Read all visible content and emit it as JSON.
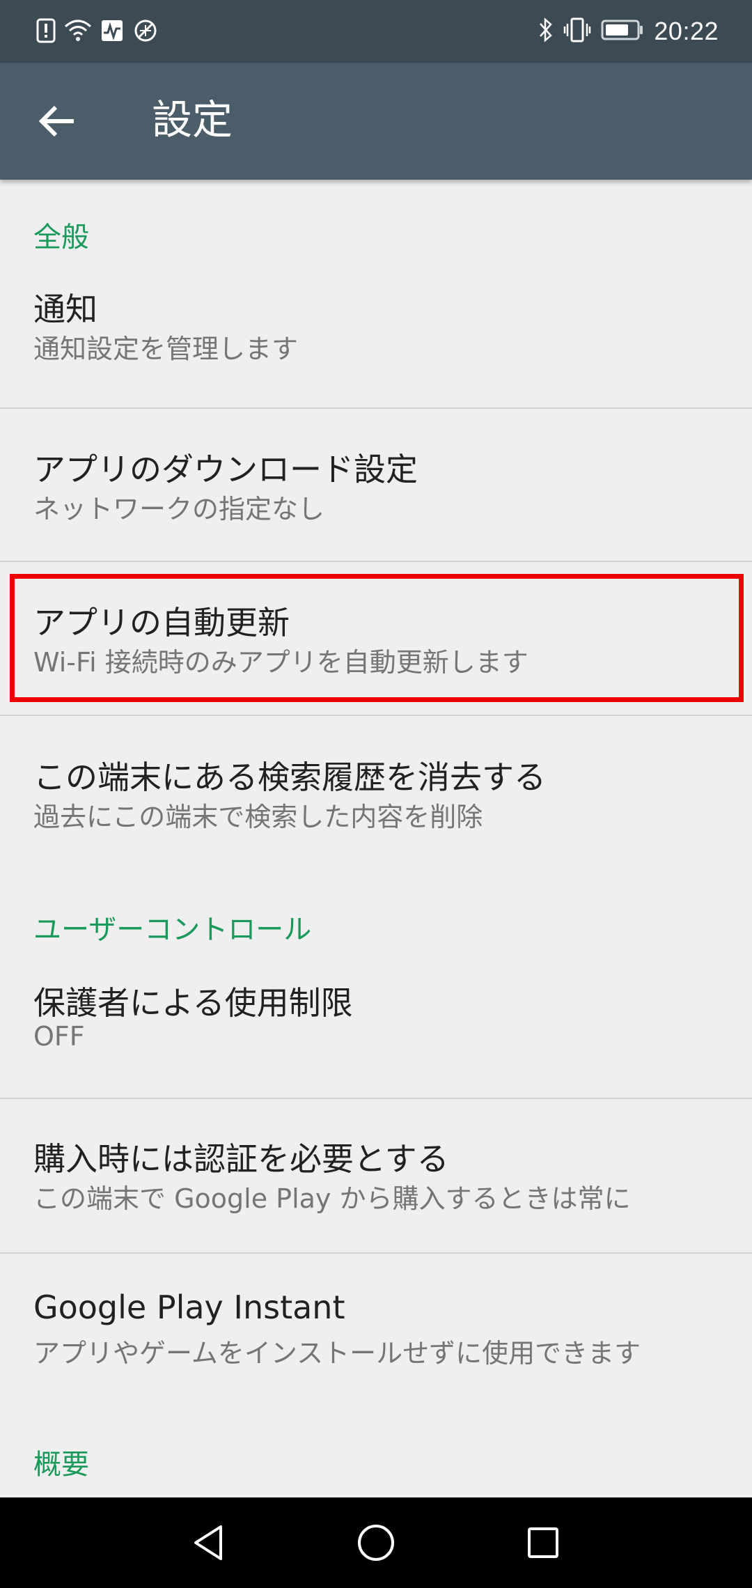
{
  "status_bar": {
    "time": "20:22",
    "left_icons": [
      "alert-icon",
      "wifi-icon",
      "activity-icon",
      "data-saver-icon"
    ],
    "right_icons": [
      "bluetooth-icon",
      "vibrate-icon",
      "battery-icon"
    ]
  },
  "app_bar": {
    "title": "設定",
    "back_icon": "arrow-back-icon"
  },
  "sections": {
    "general": {
      "header": "全般",
      "items": [
        {
          "primary": "通知",
          "secondary": "通知設定を管理します"
        },
        {
          "primary": "アプリのダウンロード設定",
          "secondary": "ネットワークの指定なし"
        },
        {
          "primary": "アプリの自動更新",
          "secondary": "Wi-Fi 接続時のみアプリを自動更新します"
        },
        {
          "primary": "この端末にある検索履歴を消去する",
          "secondary": "過去にこの端末で検索した内容を削除"
        }
      ]
    },
    "user_controls": {
      "header": "ユーザーコントロール",
      "items": [
        {
          "primary": "保護者による使用制限",
          "secondary": "OFF"
        },
        {
          "primary": "購入時には認証を必要とする",
          "secondary": "この端末で Google Play から購入するときは常に"
        },
        {
          "primary": "Google Play Instant",
          "secondary": "アプリやゲームをインストールせずに使用できます"
        }
      ]
    },
    "about": {
      "header": "概要"
    }
  },
  "colors": {
    "status_bar": "#3b4a53",
    "app_bar": "#4a5d68",
    "accent": "#1a9a5a",
    "highlight": "#ef0000",
    "background": "#efefef"
  },
  "nav_bar": {
    "buttons": [
      "back-triangle-icon",
      "home-circle-icon",
      "recents-square-icon"
    ]
  }
}
